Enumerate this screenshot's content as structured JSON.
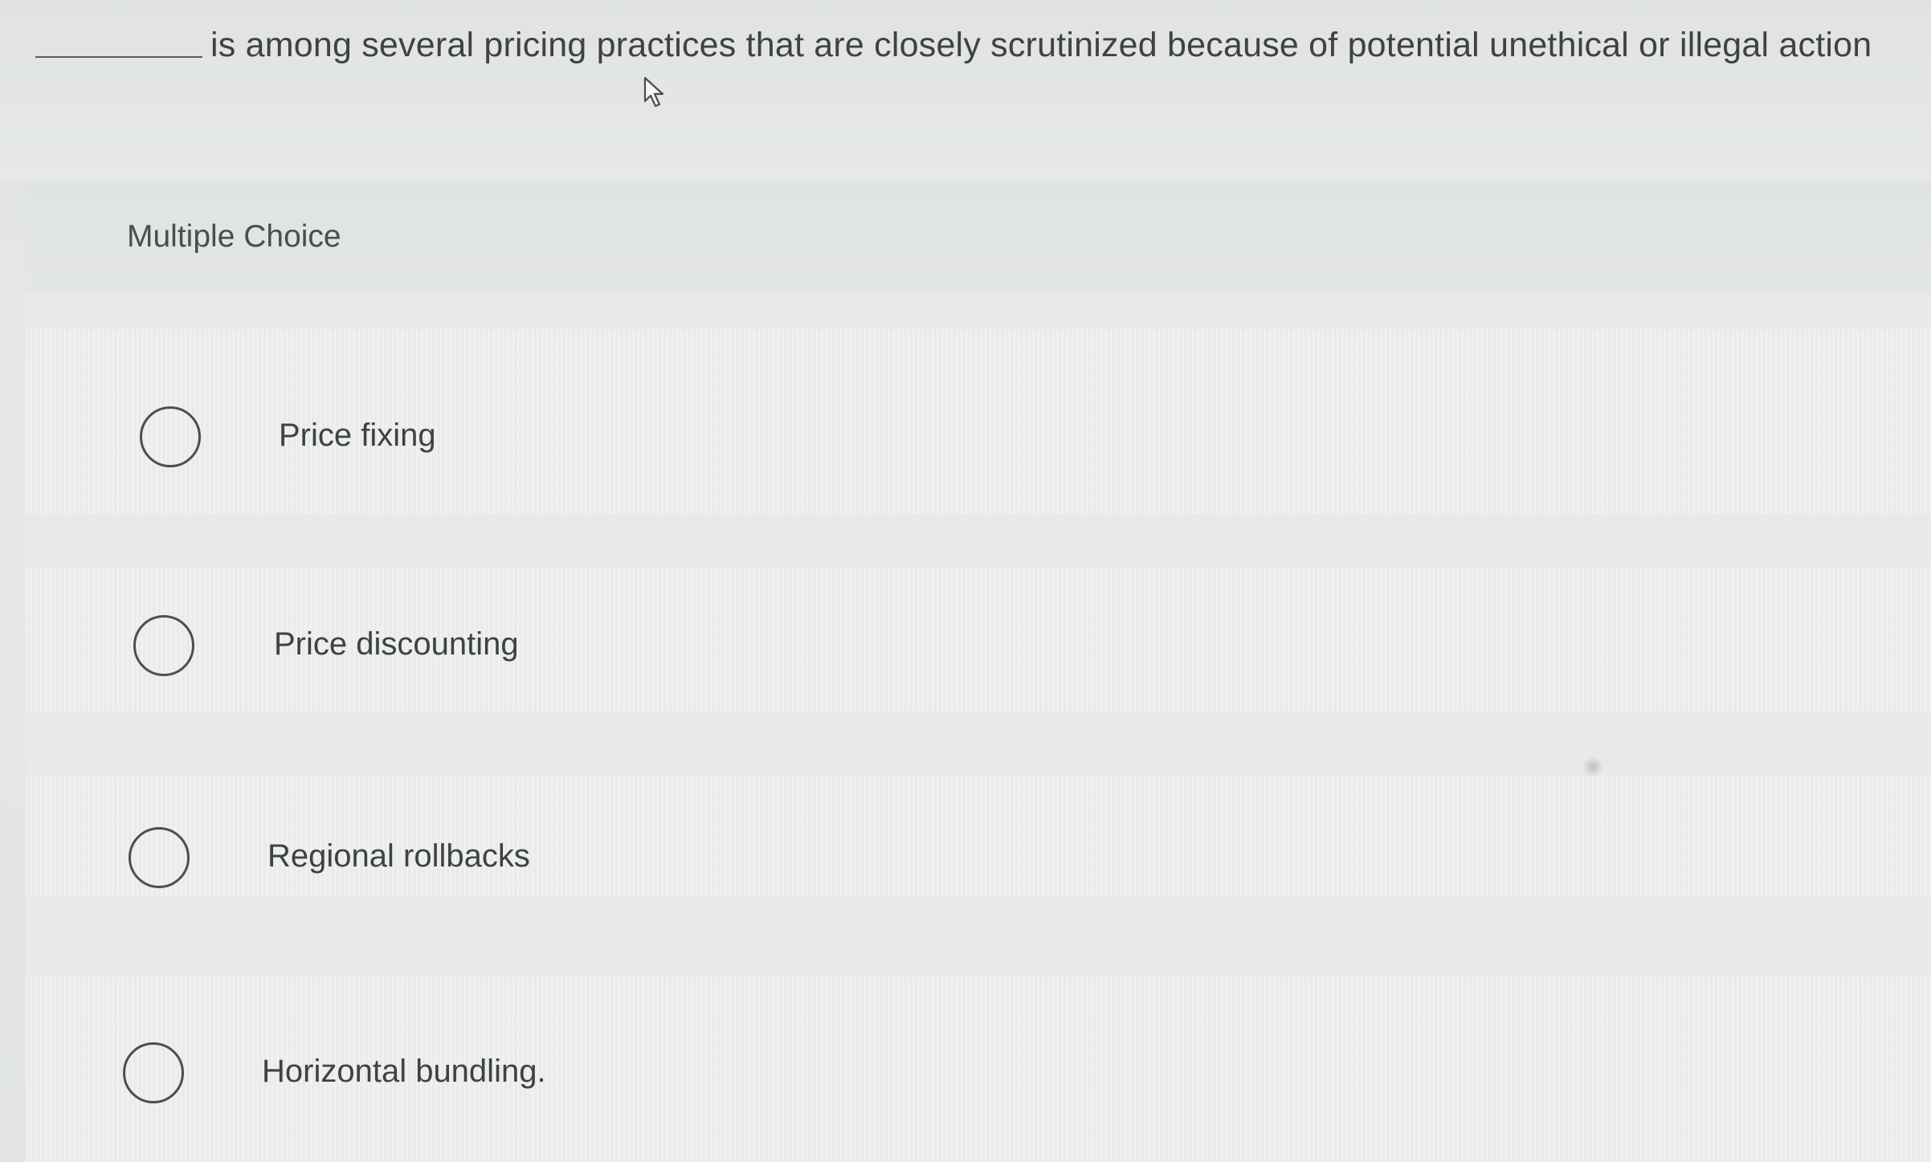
{
  "question": {
    "blank": "__________",
    "text": "is among several pricing practices that are closely scrutinized because of potential unethical or illegal action"
  },
  "panel": {
    "label": "Multiple Choice"
  },
  "options": [
    {
      "label": "Price fixing",
      "selected": false
    },
    {
      "label": "Price discounting",
      "selected": false
    },
    {
      "label": "Regional rollbacks",
      "selected": false
    },
    {
      "label": "Horizontal bundling.",
      "selected": false
    }
  ],
  "colors": {
    "background": "#e5e8e7",
    "text": "#3f4243",
    "radio_border": "#4c4f50"
  },
  "icons": {
    "cursor": "mouse-pointer-icon"
  }
}
